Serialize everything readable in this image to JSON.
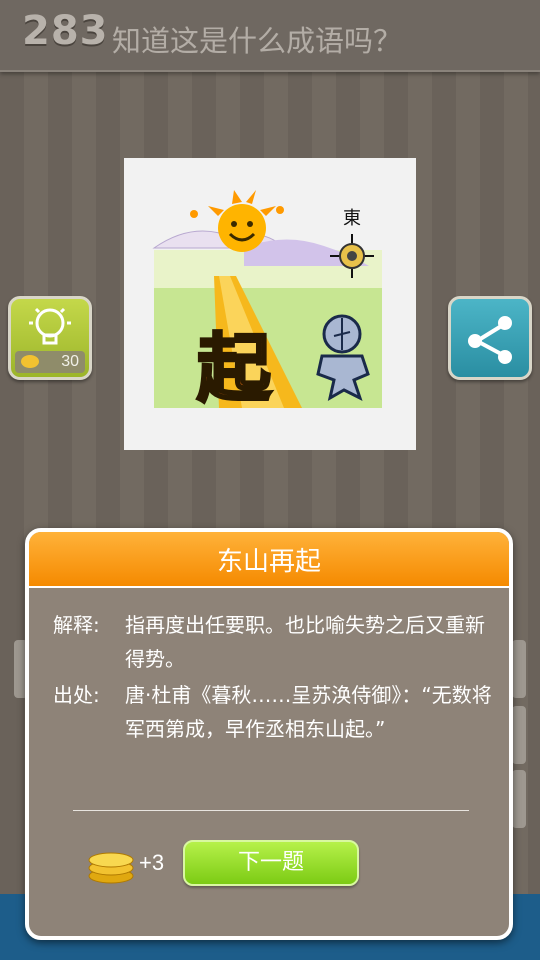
{
  "header": {
    "level": "283",
    "question": "知道这是什么成语吗？"
  },
  "puzzle": {
    "direction_char": "東",
    "big_char": "起"
  },
  "hint": {
    "cost": "30"
  },
  "modal": {
    "title": "东山再起",
    "meaning_label": "解释:",
    "meaning_text": "指再度出任要职。也比喻失势之后又重新得势。",
    "source_label": "出处:",
    "source_text": "唐·杜甫《暮秋……呈苏涣侍御》：“无数将军西第成，早作丞相东山起。”",
    "reward": "+3",
    "next_label": "下一题"
  },
  "colors": {
    "accent_orange": "#f58a00",
    "next_green": "#7ccb14",
    "hint_green": "#9cb52a",
    "share_blue": "#2a8ea2"
  }
}
